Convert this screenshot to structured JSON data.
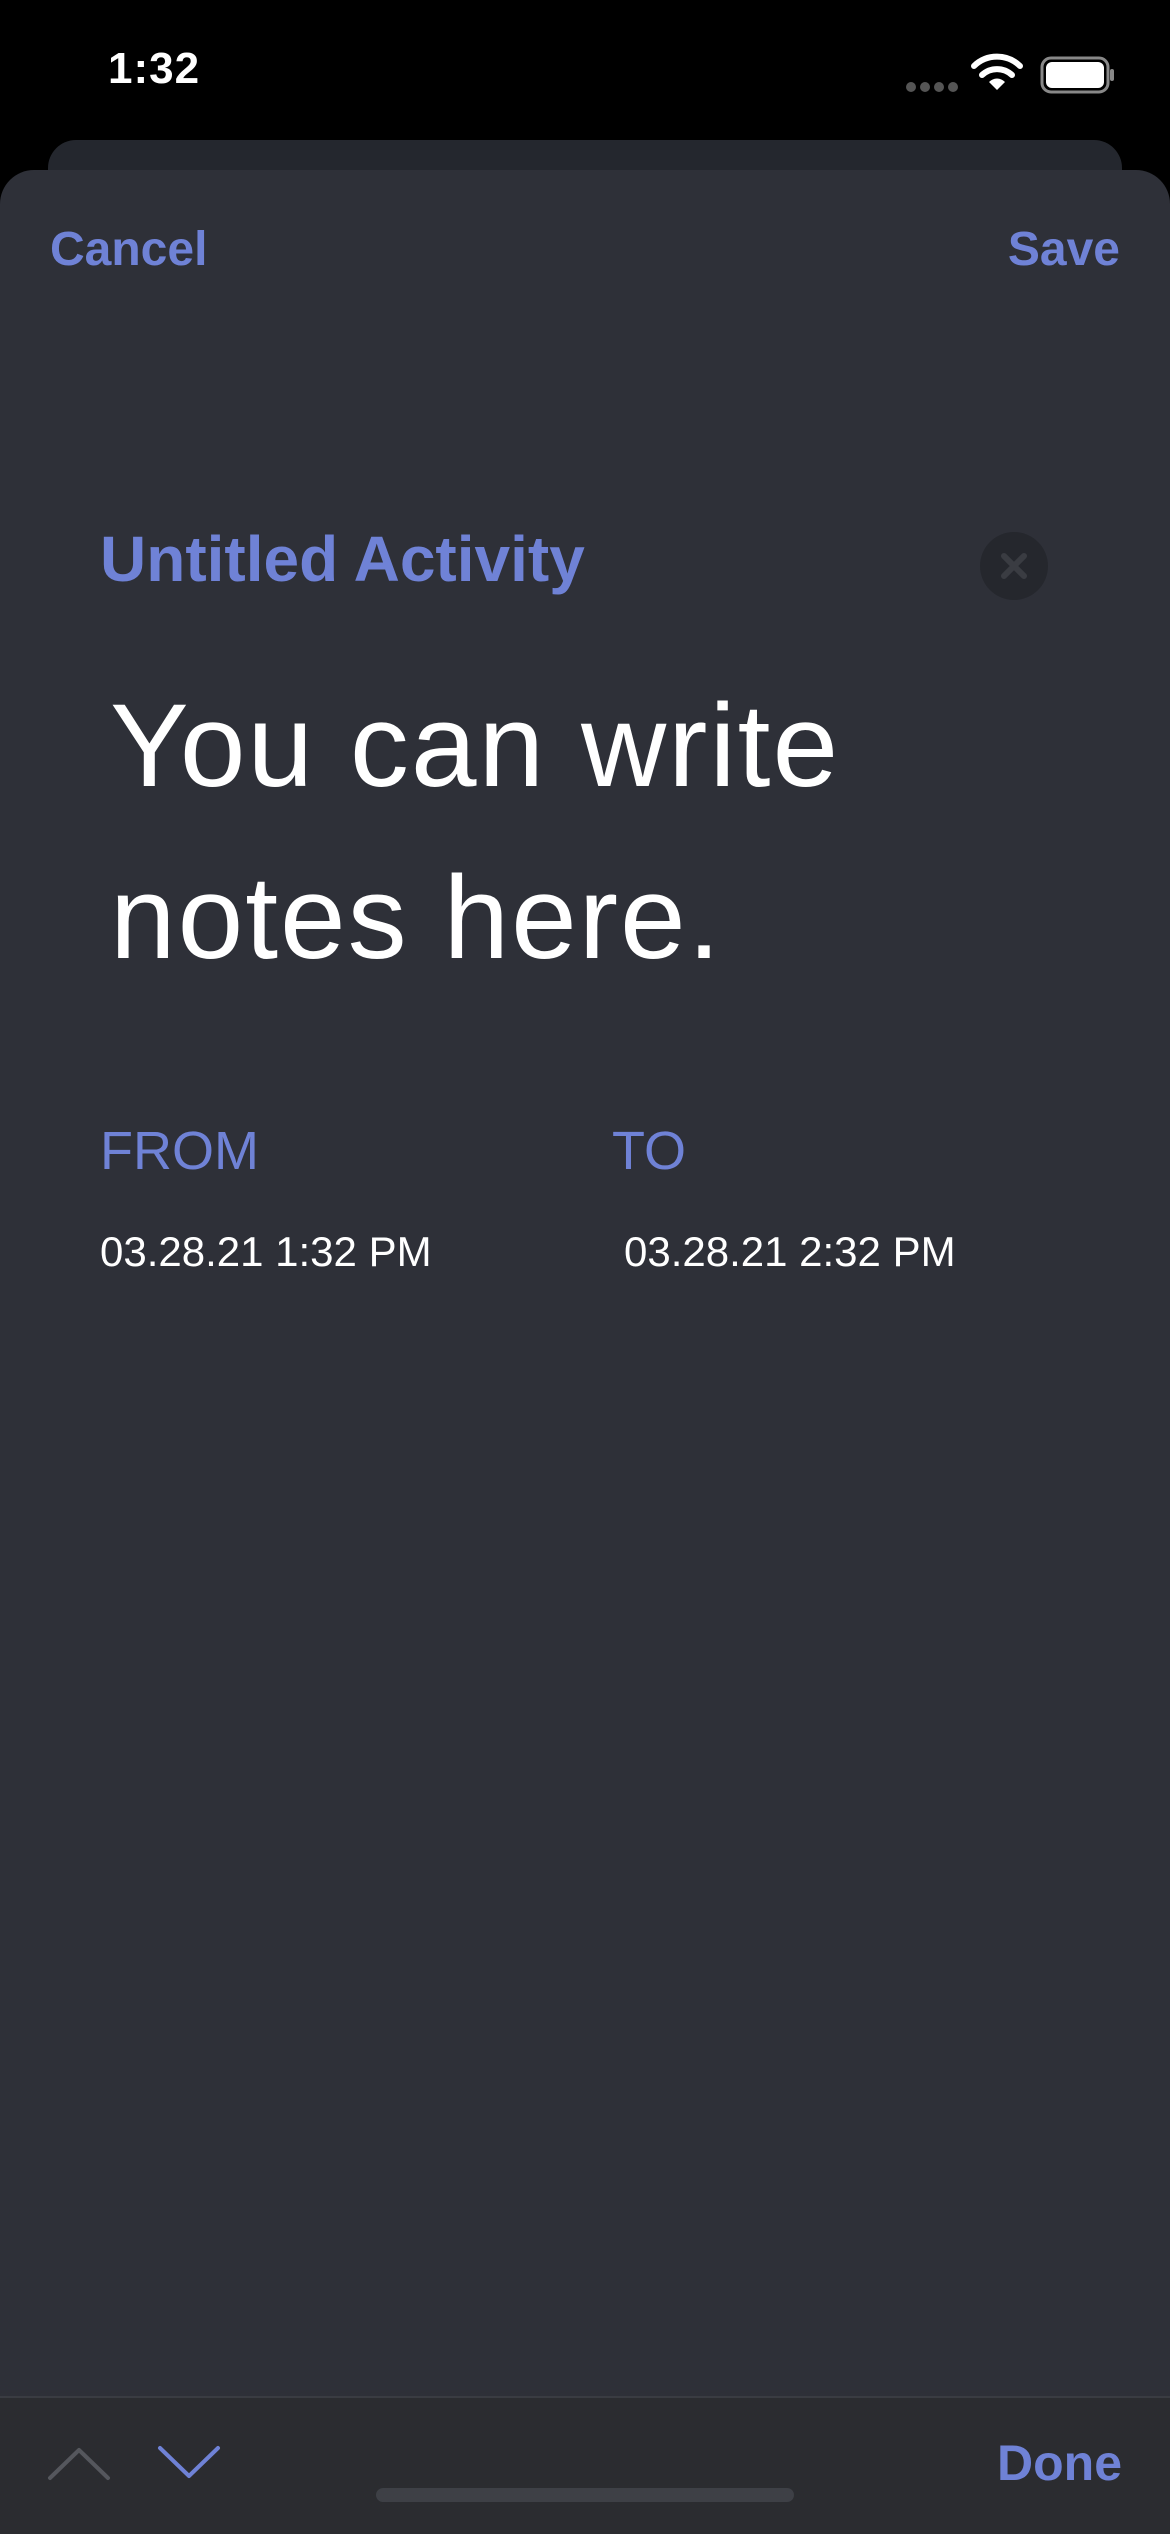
{
  "status_bar": {
    "time": "1:32",
    "icons": [
      "signal-icon",
      "wifi-icon",
      "battery-icon"
    ]
  },
  "nav": {
    "cancel_label": "Cancel",
    "save_label": "Save"
  },
  "activity": {
    "title": "Untitled Activity",
    "notes": "You can write notes here.",
    "clear_icon": "close-icon"
  },
  "range": {
    "from_label": "FROM",
    "from_value": "03.28.21 1:32 PM",
    "to_label": "TO",
    "to_value": "03.28.21 2:32 PM"
  },
  "toolbar": {
    "prev_icon": "chevron-up-icon",
    "next_icon": "chevron-down-icon",
    "done_label": "Done"
  },
  "colors": {
    "accent": "#6f82d6",
    "sheet_background": "#2e3038",
    "toolbar_background": "#2b2c30"
  }
}
